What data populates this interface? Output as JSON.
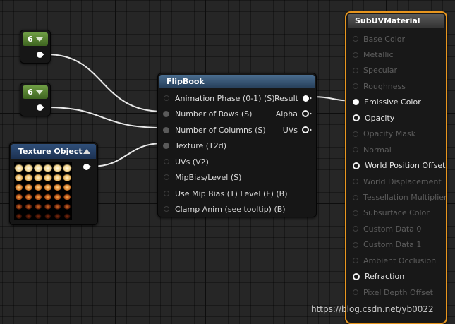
{
  "constant_nodes": [
    {
      "value": "6"
    },
    {
      "value": "6"
    }
  ],
  "texture_node": {
    "title": "Texture Object",
    "collapse_icon": "triangle-up-icon",
    "preview_colors": [
      "#fff6dc",
      "#f2d184",
      "#e69a3a",
      "#c9601c",
      "#8a2d0c",
      "#4a1404"
    ]
  },
  "flipbook_node": {
    "title": "FlipBook",
    "inputs": [
      {
        "label": "Animation  Phase (0-1) (S)",
        "connected": false
      },
      {
        "label": "Number of Rows (S)",
        "connected": true
      },
      {
        "label": "Number of Columns (S)",
        "connected": true
      },
      {
        "label": "Texture (T2d)",
        "connected": true
      },
      {
        "label": "UVs (V2)",
        "connected": false
      },
      {
        "label": "MipBias/Level (S)",
        "connected": false
      },
      {
        "label": "Use Mip Bias (T) Level (F) (B)",
        "connected": false
      },
      {
        "label": "Clamp Anim (see tooltip) (B)",
        "connected": false
      }
    ],
    "outputs": [
      {
        "label": "Result",
        "connected": true
      },
      {
        "label": "Alpha",
        "connected": false
      },
      {
        "label": "UVs",
        "connected": false
      }
    ]
  },
  "material_node": {
    "title": "SubUVMaterial",
    "accent": "#e8961e",
    "pins": [
      {
        "label": "Base Color",
        "state": "off"
      },
      {
        "label": "Metallic",
        "state": "off"
      },
      {
        "label": "Specular",
        "state": "off"
      },
      {
        "label": "Roughness",
        "state": "off"
      },
      {
        "label": "Emissive Color",
        "state": "connected"
      },
      {
        "label": "Opacity",
        "state": "on"
      },
      {
        "label": "Opacity Mask",
        "state": "off"
      },
      {
        "label": "Normal",
        "state": "off"
      },
      {
        "label": "World Position Offset",
        "state": "on"
      },
      {
        "label": "World Displacement",
        "state": "off"
      },
      {
        "label": "Tessellation Multiplier",
        "state": "off"
      },
      {
        "label": "Subsurface Color",
        "state": "off"
      },
      {
        "label": "Custom Data 0",
        "state": "off"
      },
      {
        "label": "Custom Data 1",
        "state": "off"
      },
      {
        "label": "Ambient Occlusion",
        "state": "off"
      },
      {
        "label": "Refraction",
        "state": "on"
      },
      {
        "label": "Pixel Depth Offset",
        "state": "off"
      }
    ]
  },
  "watermark": "https://blog.csdn.net/yb0022"
}
